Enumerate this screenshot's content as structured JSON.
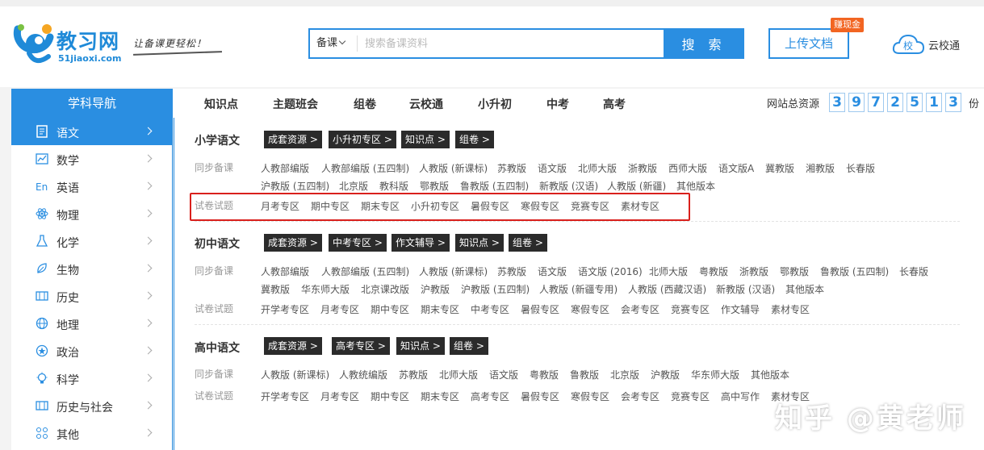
{
  "brand": {
    "name": "教习网",
    "domain": "51jiaoxi.com",
    "slogan": "让备课更轻松！"
  },
  "search": {
    "category": "备课",
    "placeholder": "搜索备课资料",
    "button": "搜 索"
  },
  "upload": {
    "label": "上传文档",
    "badge": "赚现金"
  },
  "cloud_school": {
    "icon_text": "校",
    "label": "云校通"
  },
  "nav_head": "学科导航",
  "top_nav": [
    "知识点",
    "主题班会",
    "组卷",
    "云校通",
    "小升初",
    "中考",
    "高考"
  ],
  "site_total": {
    "label": "网站总资源",
    "digits": [
      "3",
      "9",
      "7",
      "2",
      "5",
      "1",
      "3"
    ],
    "unit": "份"
  },
  "sidebar": [
    {
      "label": "语文",
      "icon": "book-icon",
      "active": true
    },
    {
      "label": "数学",
      "icon": "chart-icon"
    },
    {
      "label": "英语",
      "icon": "en-icon"
    },
    {
      "label": "物理",
      "icon": "atom-icon"
    },
    {
      "label": "化学",
      "icon": "flask-icon"
    },
    {
      "label": "生物",
      "icon": "leaf-icon"
    },
    {
      "label": "历史",
      "icon": "scroll-icon"
    },
    {
      "label": "地理",
      "icon": "globe-icon"
    },
    {
      "label": "政治",
      "icon": "emblem-icon"
    },
    {
      "label": "科学",
      "icon": "bulb-icon"
    },
    {
      "label": "历史与社会",
      "icon": "scroll-icon"
    },
    {
      "label": "其他",
      "icon": "grid-icon"
    }
  ],
  "sections": [
    {
      "title": "小学语文",
      "tags": [
        "成套资源 >",
        "小升初专区 >",
        "知识点 >",
        "组卷 >"
      ],
      "rows": [
        {
          "label": "同步备课",
          "lines": [
            [
              "人教部编版",
              "人教部编版 (五四制)",
              "人教版 (新课标)",
              "苏教版",
              "语文版",
              "北师大版",
              "浙教版",
              "西师大版",
              "语文版A",
              "冀教版",
              "湘教版",
              "长春版"
            ],
            [
              "沪教版 (五四制)",
              "北京版",
              "教科版",
              "鄂教版",
              "鲁教版 (五四制)",
              "新教版 (汉语)",
              "人教版 (新疆)",
              "其他版本"
            ]
          ]
        },
        {
          "label": "试卷试题",
          "lines": [
            [
              "月考专区",
              "期中专区",
              "期末专区",
              "小升初专区",
              "暑假专区",
              "寒假专区",
              "竞赛专区",
              "素材专区"
            ]
          ]
        }
      ]
    },
    {
      "title": "初中语文",
      "tags": [
        "成套资源 >",
        "中考专区 >",
        "作文辅导 >",
        "知识点 >",
        "组卷 >"
      ],
      "rows": [
        {
          "label": "同步备课",
          "lines": [
            [
              "人教部编版",
              "人教部编版 (五四制)",
              "人教版 (新课标)",
              "苏教版",
              "语文版",
              "语文版 (2016)",
              "北师大版",
              "粤教版",
              "浙教版",
              "鄂教版",
              "鲁教版 (五四制)",
              "长春版"
            ],
            [
              "冀教版",
              "华东师大版",
              "北京课改版",
              "沪教版",
              "沪教版 (五四制)",
              "人教版 (新疆专用)",
              "人教版 (西藏汉语)",
              "新教版 (汉语)",
              "其他版本"
            ]
          ]
        },
        {
          "label": "试卷试题",
          "lines": [
            [
              "开学考专区",
              "月考专区",
              "期中专区",
              "期末专区",
              "中考专区",
              "暑假专区",
              "寒假专区",
              "会考专区",
              "竞赛专区",
              "作文辅导",
              "素材专区"
            ]
          ]
        }
      ]
    },
    {
      "title": "高中语文",
      "tags": [
        "成套资源 >",
        "高考专区 >",
        "知识点 >",
        "组卷 >"
      ],
      "rows": [
        {
          "label": "同步备课",
          "lines": [
            [
              "人教版 (新课标)",
              "人教统编版",
              "苏教版",
              "北师大版",
              "语文版",
              "粤教版",
              "鲁教版",
              "北京版",
              "沪教版",
              "华东师大版",
              "其他版本"
            ]
          ]
        },
        {
          "label": "试卷试题",
          "lines": [
            [
              "开学考专区",
              "月考专区",
              "期中专区",
              "期末专区",
              "高考专区",
              "暑假专区",
              "寒假专区",
              "会考专区",
              "竞赛专区",
              "高中写作",
              "素材专区"
            ]
          ]
        }
      ]
    }
  ],
  "watermark": "知乎 @黄老师",
  "colors": {
    "brand_blue": "#2a8ee1",
    "tag_dark": "#2b2b2b",
    "highlight_red": "#d9201c",
    "badge_orange": "#f26522"
  }
}
